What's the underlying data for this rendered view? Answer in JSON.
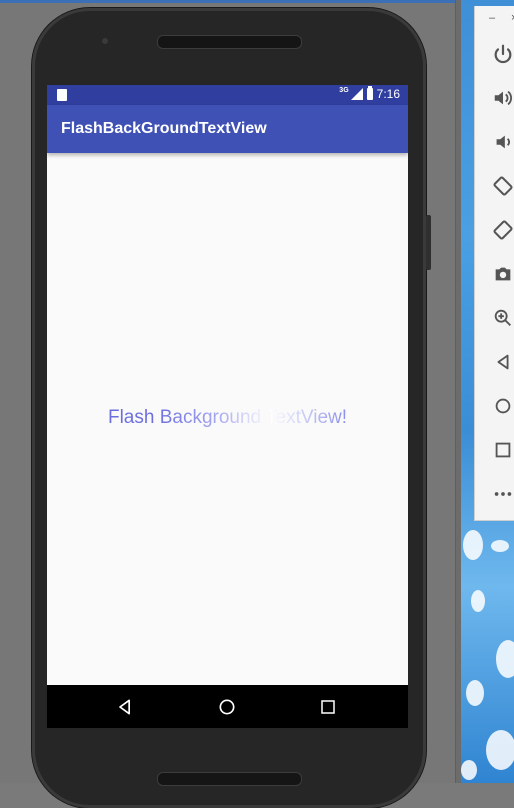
{
  "window": {
    "minimize_glyph": "–",
    "close_glyph": "×"
  },
  "status_bar": {
    "network": "3G",
    "time": "7:16"
  },
  "app": {
    "title": "FlashBackGroundTextView"
  },
  "content": {
    "text": "Flash Background TextView!"
  },
  "toolbar": {
    "items": [
      "power-icon",
      "volume-up-icon",
      "volume-down-icon",
      "rotate-left-icon",
      "rotate-right-icon",
      "camera-icon",
      "zoom-icon",
      "back-icon",
      "home-icon",
      "overview-icon",
      "more-icon"
    ]
  },
  "navigation": {
    "items": [
      "back-icon",
      "home-icon",
      "recents-icon"
    ]
  },
  "colors": {
    "primary": "#3f51b5",
    "primary_dark": "#303f9f",
    "text_accent": "#6c6ee0"
  }
}
